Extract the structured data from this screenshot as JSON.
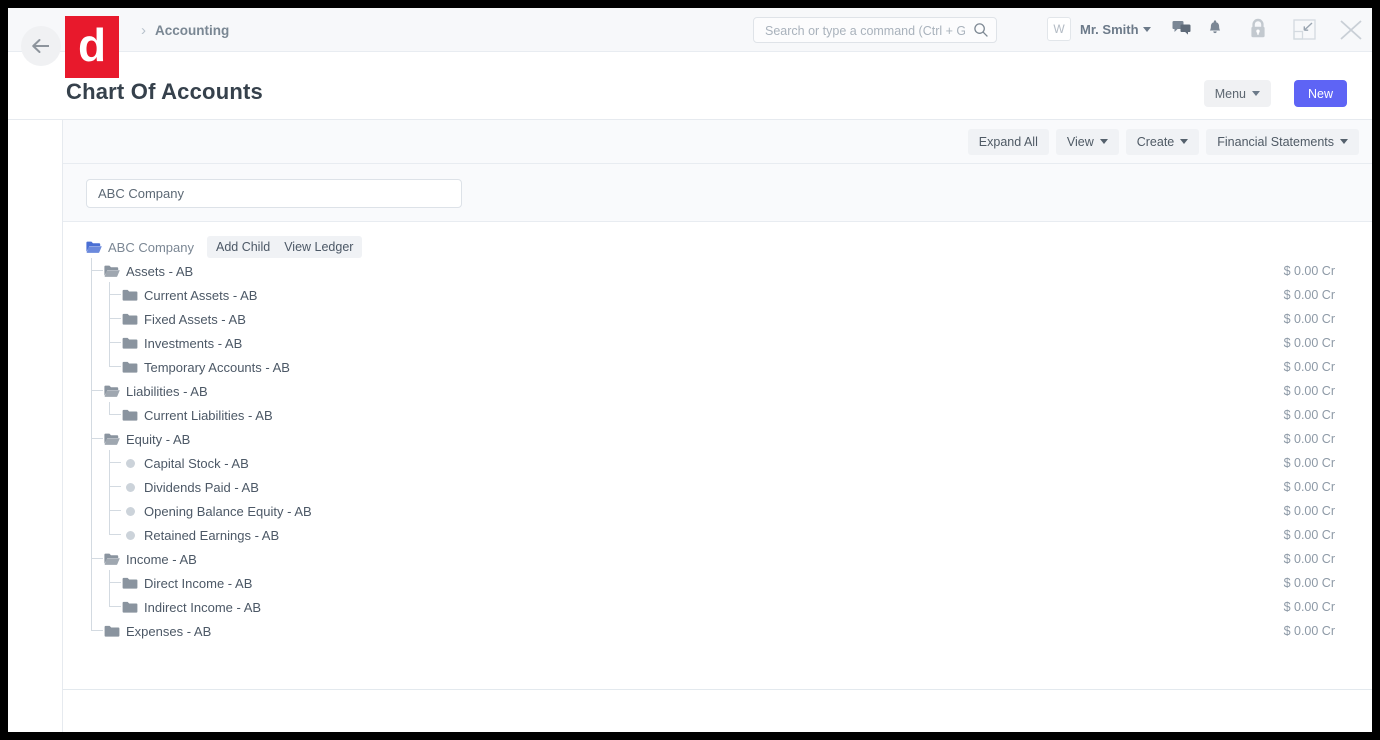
{
  "window": {
    "back_icon": "arrow-left-icon",
    "logo_letter": "d",
    "breadcrumb_separator": "›",
    "breadcrumb": "Accounting"
  },
  "search": {
    "placeholder": "Search or type a command (Ctrl + G)",
    "value": "",
    "icon": "search-icon"
  },
  "user": {
    "avatar_initial": "W",
    "name": "Mr. Smith",
    "caret": "▾"
  },
  "nav_icons": [
    {
      "name": "chat-icon"
    },
    {
      "name": "notification-bell-icon"
    },
    {
      "name": "lock-icon"
    },
    {
      "name": "minimize-icon"
    },
    {
      "name": "close-icon"
    }
  ],
  "page": {
    "title": "Chart Of Accounts",
    "menu_label": "Menu",
    "new_label": "New"
  },
  "toolbar": {
    "buttons": [
      {
        "label": "Expand All",
        "has_caret": false
      },
      {
        "label": "View",
        "has_caret": true
      },
      {
        "label": "Create",
        "has_caret": true
      },
      {
        "label": "Financial Statements",
        "has_caret": true
      }
    ]
  },
  "filter": {
    "placeholder": "ABC Company",
    "value": "ABC Company"
  },
  "tree": {
    "root_actions": [
      "Add Child",
      "View Ledger"
    ],
    "nodes": [
      {
        "label": "ABC Company",
        "depth": 0,
        "icon": "folder-open-blue-icon",
        "balance": "",
        "actions": true,
        "root": true
      },
      {
        "label": "Assets - AB",
        "depth": 1,
        "icon": "folder-open-icon",
        "balance": "$ 0.00 Cr",
        "actions": false,
        "root": false
      },
      {
        "label": "Current Assets - AB",
        "depth": 2,
        "icon": "folder-icon",
        "balance": "$ 0.00 Cr",
        "actions": false,
        "root": false
      },
      {
        "label": "Fixed Assets - AB",
        "depth": 2,
        "icon": "folder-icon",
        "balance": "$ 0.00 Cr",
        "actions": false,
        "root": false
      },
      {
        "label": "Investments - AB",
        "depth": 2,
        "icon": "folder-icon",
        "balance": "$ 0.00 Cr",
        "actions": false,
        "root": false
      },
      {
        "label": "Temporary Accounts - AB",
        "depth": 2,
        "icon": "folder-icon",
        "balance": "$ 0.00 Cr",
        "actions": false,
        "root": false
      },
      {
        "label": "Liabilities - AB",
        "depth": 1,
        "icon": "folder-open-icon",
        "balance": "$ 0.00 Cr",
        "actions": false,
        "root": false
      },
      {
        "label": "Current Liabilities - AB",
        "depth": 2,
        "icon": "folder-icon",
        "balance": "$ 0.00 Cr",
        "actions": false,
        "root": false
      },
      {
        "label": "Equity - AB",
        "depth": 1,
        "icon": "folder-open-icon",
        "balance": "$ 0.00 Cr",
        "actions": false,
        "root": false
      },
      {
        "label": "Capital Stock - AB",
        "depth": 2,
        "icon": "leaf-dot-icon",
        "balance": "$ 0.00 Cr",
        "actions": false,
        "root": false
      },
      {
        "label": "Dividends Paid - AB",
        "depth": 2,
        "icon": "leaf-dot-icon",
        "balance": "$ 0.00 Cr",
        "actions": false,
        "root": false
      },
      {
        "label": "Opening Balance Equity - AB",
        "depth": 2,
        "icon": "leaf-dot-icon",
        "balance": "$ 0.00 Cr",
        "actions": false,
        "root": false
      },
      {
        "label": "Retained Earnings - AB",
        "depth": 2,
        "icon": "leaf-dot-icon",
        "balance": "$ 0.00 Cr",
        "actions": false,
        "root": false
      },
      {
        "label": "Income - AB",
        "depth": 1,
        "icon": "folder-open-icon",
        "balance": "$ 0.00 Cr",
        "actions": false,
        "root": false
      },
      {
        "label": "Direct Income - AB",
        "depth": 2,
        "icon": "folder-icon",
        "balance": "$ 0.00 Cr",
        "actions": false,
        "root": false
      },
      {
        "label": "Indirect Income - AB",
        "depth": 2,
        "icon": "folder-icon",
        "balance": "$ 0.00 Cr",
        "actions": false,
        "root": false
      },
      {
        "label": "Expenses - AB",
        "depth": 1,
        "icon": "folder-icon",
        "balance": "$ 0.00 Cr",
        "actions": false,
        "root": false
      }
    ]
  },
  "colors": {
    "brand_red": "#e8192c",
    "primary_button": "#5e64f5",
    "folder_blue": "#4a6fd4",
    "folder_gray": "#8a949f",
    "text": "#4c5866",
    "muted": "#8d99a6"
  }
}
